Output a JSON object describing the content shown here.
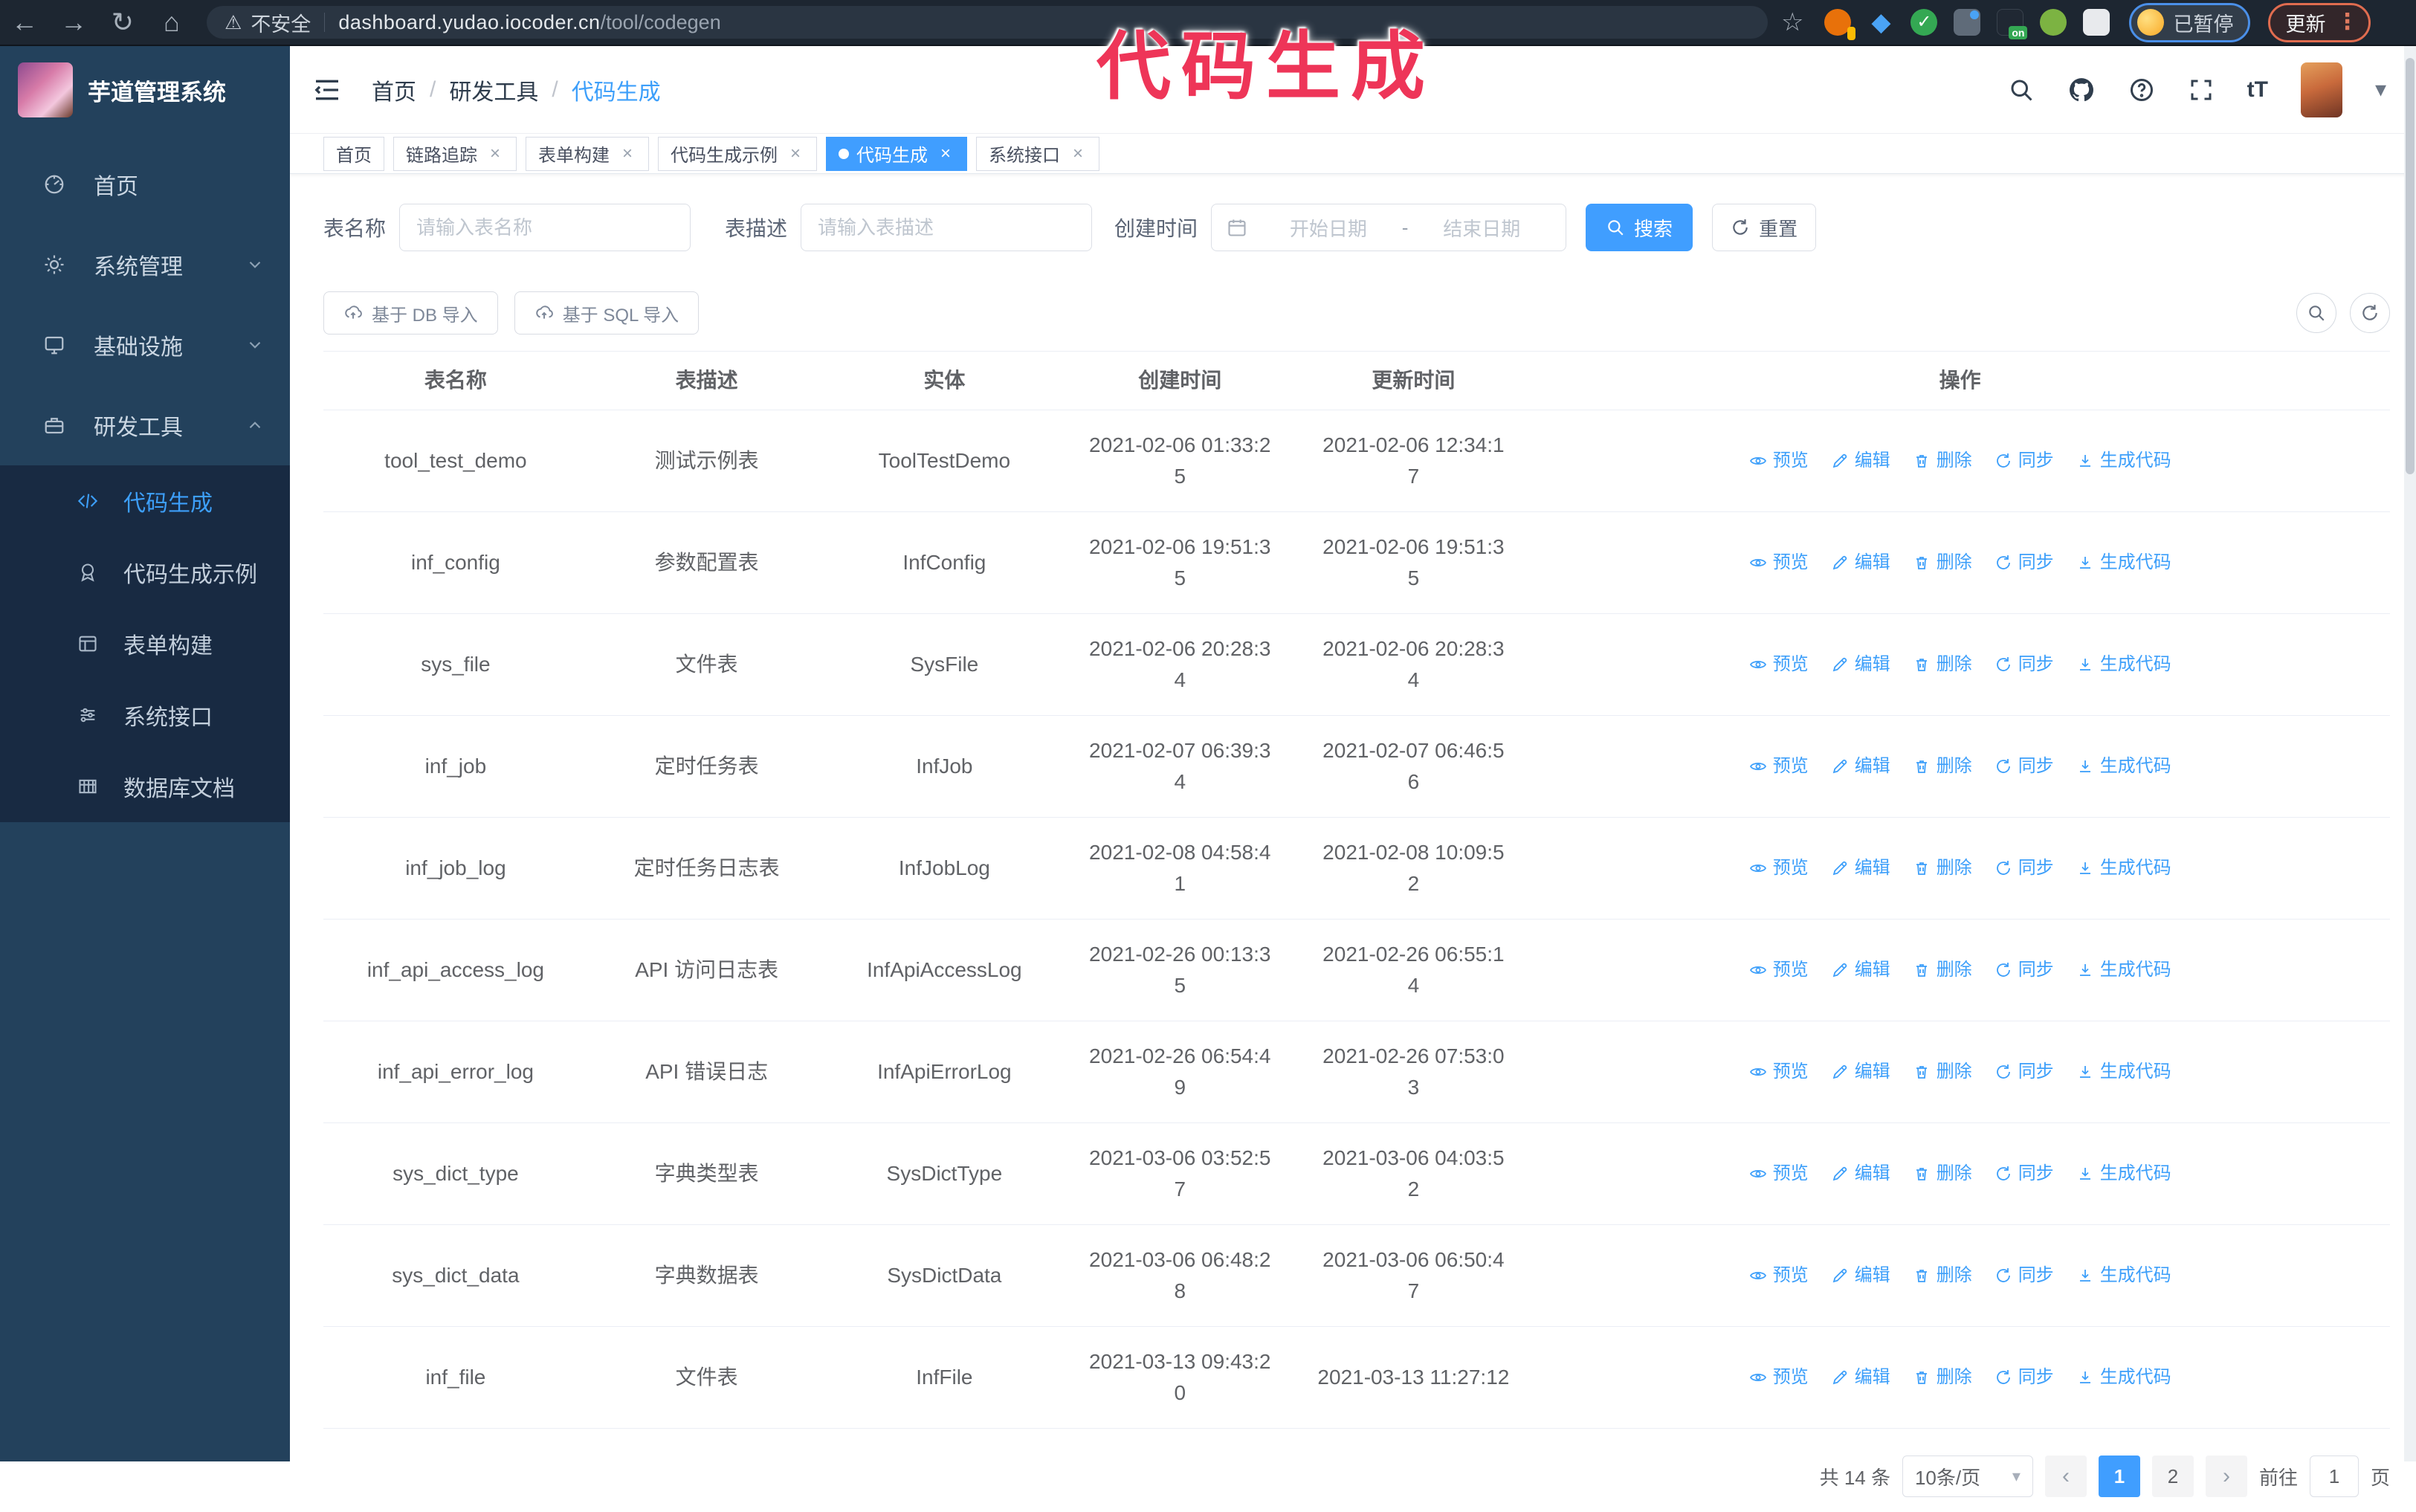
{
  "theme": {
    "primary": "#409eff"
  },
  "annotation": {
    "text": "代码生成",
    "color": "#ee3558"
  },
  "icons": {
    "back": "←",
    "forward": "→",
    "reload": "↻",
    "home": "⌂",
    "warning": "⚠",
    "star": "☆",
    "caret_down": "▾",
    "dots_vertical": "⋮",
    "prev": "‹",
    "next": "›",
    "font_size": "tT"
  },
  "browser": {
    "security_label": "不安全",
    "url_host": "dashboard.yudao.iocoder.cn",
    "url_path": "/tool/codegen",
    "profile_badge": "已暂停",
    "update_label": "更新"
  },
  "sidebar": {
    "logo_title": "芋道管理系统",
    "items": [
      {
        "label": "首页"
      },
      {
        "label": "系统管理"
      },
      {
        "label": "基础设施"
      },
      {
        "label": "研发工具"
      }
    ],
    "submenu": [
      {
        "label": "代码生成"
      },
      {
        "label": "代码生成示例"
      },
      {
        "label": "表单构建"
      },
      {
        "label": "系统接口"
      },
      {
        "label": "数据库文档"
      }
    ]
  },
  "breadcrumb": [
    "首页",
    "研发工具",
    "代码生成"
  ],
  "tags": [
    {
      "label": "首页"
    },
    {
      "label": "链路追踪"
    },
    {
      "label": "表单构建"
    },
    {
      "label": "代码生成示例"
    },
    {
      "label": "代码生成"
    },
    {
      "label": "系统接口"
    }
  ],
  "search_form": {
    "name_label": "表名称",
    "name_placeholder": "请输入表名称",
    "desc_label": "表描述",
    "desc_placeholder": "请输入表描述",
    "time_label": "创建时间",
    "start_placeholder": "开始日期",
    "range_separator": "-",
    "end_placeholder": "结束日期",
    "search_label": "搜索",
    "reset_label": "重置"
  },
  "toolbar": {
    "import_db_label": "基于 DB 导入",
    "import_sql_label": "基于 SQL 导入"
  },
  "table": {
    "headers": [
      "表名称",
      "表描述",
      "实体",
      "创建时间",
      "更新时间",
      "操作"
    ],
    "actions": [
      {
        "label": "预览",
        "icon": "eye-icon"
      },
      {
        "label": "编辑",
        "icon": "edit-icon"
      },
      {
        "label": "删除",
        "icon": "delete-icon"
      },
      {
        "label": "同步",
        "icon": "sync-icon"
      },
      {
        "label": "生成代码",
        "icon": "download-icon"
      }
    ],
    "rows": [
      {
        "name": "tool_test_demo",
        "desc": "测试示例表",
        "entity": "ToolTestDemo",
        "created": "2021-02-06 01:33:25",
        "updated": "2021-02-06 12:34:17"
      },
      {
        "name": "inf_config",
        "desc": "参数配置表",
        "entity": "InfConfig",
        "created": "2021-02-06 19:51:35",
        "updated": "2021-02-06 19:51:35"
      },
      {
        "name": "sys_file",
        "desc": "文件表",
        "entity": "SysFile",
        "created": "2021-02-06 20:28:34",
        "updated": "2021-02-06 20:28:34"
      },
      {
        "name": "inf_job",
        "desc": "定时任务表",
        "entity": "InfJob",
        "created": "2021-02-07 06:39:34",
        "updated": "2021-02-07 06:46:56"
      },
      {
        "name": "inf_job_log",
        "desc": "定时任务日志表",
        "entity": "InfJobLog",
        "created": "2021-02-08 04:58:41",
        "updated": "2021-02-08 10:09:52"
      },
      {
        "name": "inf_api_access_log",
        "desc": "API 访问日志表",
        "entity": "InfApiAccessLog",
        "created": "2021-02-26 00:13:35",
        "updated": "2021-02-26 06:55:14"
      },
      {
        "name": "inf_api_error_log",
        "desc": "API 错误日志",
        "entity": "InfApiErrorLog",
        "created": "2021-02-26 06:54:49",
        "updated": "2021-02-26 07:53:03"
      },
      {
        "name": "sys_dict_type",
        "desc": "字典类型表",
        "entity": "SysDictType",
        "created": "2021-03-06 03:52:57",
        "updated": "2021-03-06 04:03:52"
      },
      {
        "name": "sys_dict_data",
        "desc": "字典数据表",
        "entity": "SysDictData",
        "created": "2021-03-06 06:48:28",
        "updated": "2021-03-06 06:50:47"
      },
      {
        "name": "inf_file",
        "desc": "文件表",
        "entity": "InfFile",
        "created": "2021-03-13 09:43:20",
        "updated": "2021-03-13 11:27:12"
      }
    ]
  },
  "pagination": {
    "total": "共 14 条",
    "page_size": "10条/页",
    "pages": [
      "1",
      "2"
    ],
    "active_page": "1",
    "goto_label": "前往",
    "goto_value": "1",
    "page_unit": "页"
  }
}
